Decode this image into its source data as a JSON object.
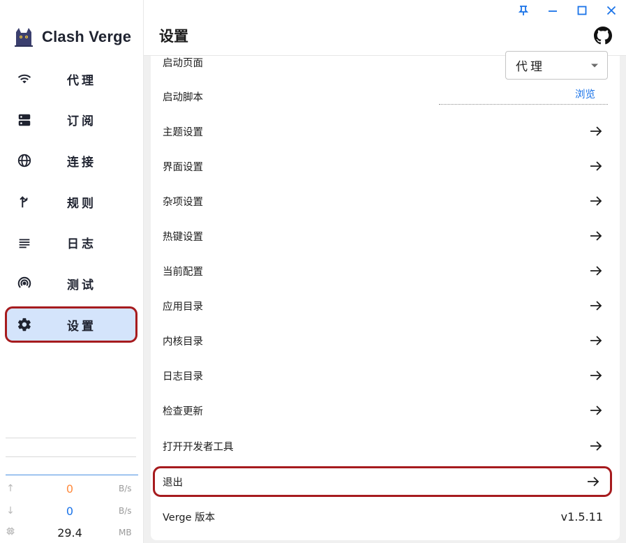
{
  "app": {
    "name": "Clash Verge"
  },
  "sidebar": {
    "items": [
      {
        "label": "代理",
        "icon": "wifi-icon"
      },
      {
        "label": "订阅",
        "icon": "dns-icon"
      },
      {
        "label": "连接",
        "icon": "globe-icon"
      },
      {
        "label": "规则",
        "icon": "fork-icon"
      },
      {
        "label": "日志",
        "icon": "list-icon"
      },
      {
        "label": "测试",
        "icon": "radar-icon"
      },
      {
        "label": "设置",
        "icon": "gear-icon",
        "active": true
      }
    ],
    "stats": {
      "upload": {
        "value": "0",
        "unit": "B/s",
        "color": "#ff8a3d"
      },
      "download": {
        "value": "0",
        "unit": "B/s",
        "color": "#1a73e8"
      },
      "memory": {
        "value": "29.4",
        "unit": "MB"
      }
    }
  },
  "header": {
    "title": "设置"
  },
  "settings": {
    "start_page": {
      "label": "启动页面",
      "value": "代理"
    },
    "start_script": {
      "label": "启动脚本",
      "action": "浏览"
    },
    "rows": [
      "主题设置",
      "界面设置",
      "杂项设置",
      "热键设置",
      "当前配置",
      "应用目录",
      "内核目录",
      "日志目录",
      "检查更新",
      "打开开发者工具"
    ],
    "exit": "退出",
    "version": {
      "label": "Verge 版本",
      "value": "v1.5.11"
    }
  },
  "colors": {
    "accent": "#1a73e8",
    "highlight": "#a61b1e",
    "active_bg": "#d4e4fb"
  }
}
